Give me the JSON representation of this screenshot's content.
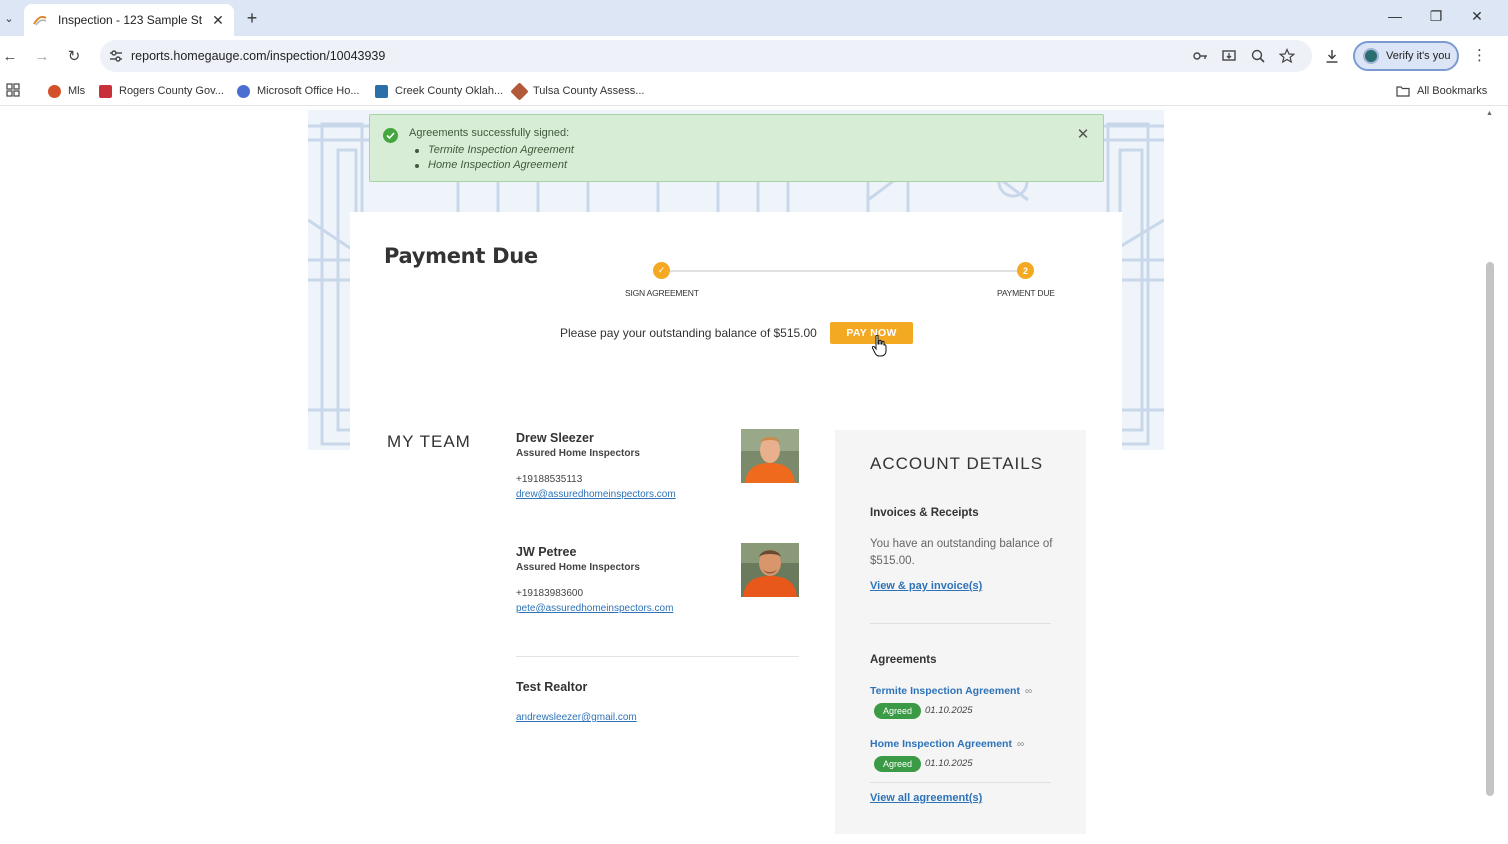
{
  "browser": {
    "tab_title": "Inspection - 123 Sample St",
    "url": "reports.homegauge.com/inspection/10043939",
    "verify_label": "Verify it's you",
    "bookmarks": [
      {
        "label": "Mls",
        "color": "#d4502a"
      },
      {
        "label": "Rogers County Gov...",
        "color": "#c8303a"
      },
      {
        "label": "Microsoft Office Ho...",
        "color": "#4a6fd0"
      },
      {
        "label": "Creek County Oklah...",
        "color": "#2a6fa8"
      },
      {
        "label": "Tulsa County Assess...",
        "color": "#b05a3a"
      }
    ],
    "all_bookmarks": "All Bookmarks"
  },
  "alert": {
    "title": "Agreements successfully signed:",
    "items": [
      "Termite Inspection Agreement",
      "Home Inspection Agreement"
    ]
  },
  "payment": {
    "title": "Payment Due",
    "steps": [
      {
        "label": "SIGN AGREEMENT",
        "marker": "✓"
      },
      {
        "label": "PAYMENT DUE",
        "marker": "2"
      }
    ],
    "balance_text": "Please pay your outstanding balance of $515.00",
    "pay_button": "PAY NOW"
  },
  "team": {
    "heading": "MY TEAM",
    "members": [
      {
        "name": "Drew Sleezer",
        "company": "Assured Home Inspectors",
        "phone": "+19188535113",
        "email": "drew@assuredhomeinspectors.com"
      },
      {
        "name": "JW Petree",
        "company": "Assured Home Inspectors",
        "phone": "+19183983600",
        "email": "pete@assuredhomeinspectors.com"
      }
    ],
    "realtor": {
      "name": "Test Realtor",
      "email": "andrewsleezer@gmail.com"
    }
  },
  "account": {
    "heading": "ACCOUNT DETAILS",
    "invoices_heading": "Invoices & Receipts",
    "invoices_text": "You have an outstanding balance of $515.00.",
    "invoices_link": "View & pay invoice(s)",
    "agreements_heading": "Agreements",
    "agreements": [
      {
        "name": "Termite Inspection Agreement",
        "status": "Agreed",
        "date": "01.10.2025"
      },
      {
        "name": "Home Inspection Agreement",
        "status": "Agreed",
        "date": "01.10.2025"
      }
    ],
    "all_agreements_link": "View all agreement(s)"
  },
  "colors": {
    "accent_orange": "#f3a922",
    "link_blue": "#2e73b8",
    "success_green": "#3b9a45",
    "alert_bg": "#d8edd6"
  }
}
